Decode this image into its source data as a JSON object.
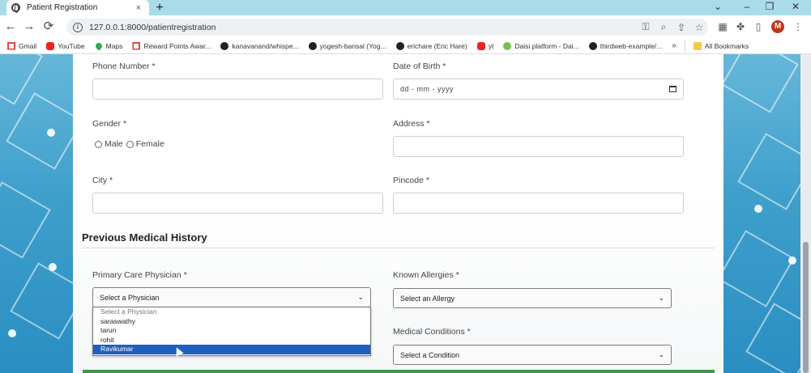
{
  "browser": {
    "tab_title": "Patient Registration",
    "tab_close": "×",
    "new_tab": "+",
    "window_controls": [
      "⌄",
      "–",
      "❐",
      "✕"
    ],
    "nav": {
      "back": "←",
      "forward": "→",
      "reload": "⟳"
    },
    "url": "127.0.0.1:8000/patientregistration",
    "omnibox_icons": [
      "key-icon",
      "zoom-icon",
      "share-icon",
      "star-icon"
    ],
    "profile_initial": "M"
  },
  "bookmarks": [
    {
      "icon": "gmail",
      "label": "Gmail"
    },
    {
      "icon": "yt",
      "label": "YouTube"
    },
    {
      "icon": "maps",
      "label": "Maps"
    },
    {
      "icon": "gmail",
      "label": "Reward Points Awar..."
    },
    {
      "icon": "gh",
      "label": "kanavanand/whispe..."
    },
    {
      "icon": "gh",
      "label": "yogesh-bansal (Yog..."
    },
    {
      "icon": "gh",
      "label": "erichare (Eric Hare)"
    },
    {
      "icon": "yt",
      "label": "yt"
    },
    {
      "icon": "daisi",
      "label": "Daisi platform - Dai..."
    },
    {
      "icon": "gh",
      "label": "thirdweb-example/..."
    }
  ],
  "bookmarks_more": "»",
  "all_bookmarks": "All Bookmarks",
  "form": {
    "phone_label": "Phone Number *",
    "dob_label": "Date of Birth *",
    "dob_placeholder": "dd - mm - yyyy",
    "gender_label": "Gender *",
    "gender_options": [
      "Male",
      "Female"
    ],
    "address_label": "Address *",
    "city_label": "City *",
    "pincode_label": "Pincode *",
    "section_title": "Previous Medical History",
    "physician_label": "Primary Care Physician *",
    "physician_selected": "Select a Physician",
    "physician_options": [
      "Select a Physician",
      "saraswathy",
      "tarun",
      "rohit",
      "Ravikumar"
    ],
    "physician_highlighted": "Ravikumar",
    "allergies_label": "Known Allergies *",
    "allergies_selected": "Select an Allergy",
    "conditions_label": "Medical Conditions *",
    "conditions_selected": "Select a Condition"
  },
  "colors": {
    "highlight": "#1f5fbf",
    "accent_green": "#3c9a4a",
    "profile": "#c4331b"
  }
}
